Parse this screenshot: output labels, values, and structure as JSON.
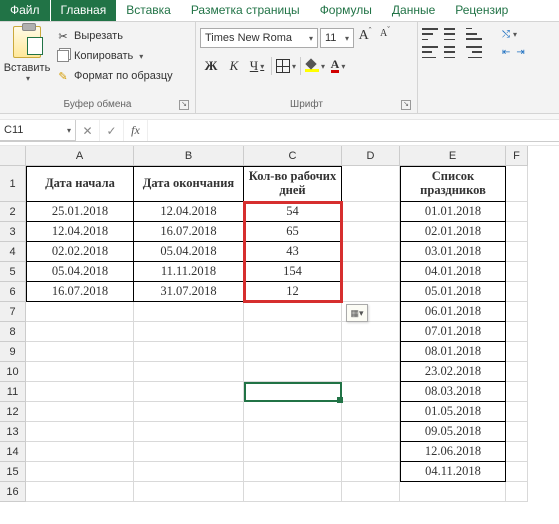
{
  "tabs": {
    "file": "Файл",
    "home": "Главная",
    "insert": "Вставка",
    "layout": "Разметка страницы",
    "formulas": "Формулы",
    "data": "Данные",
    "review": "Рецензир"
  },
  "ribbon": {
    "paste": "Вставить",
    "cut": "Вырезать",
    "copy": "Копировать",
    "format_painter": "Формат по образцу",
    "clipboard_group": "Буфер обмена",
    "font_group": "Шрифт",
    "font_name": "Times New Roma",
    "font_size": "11",
    "bold": "Ж",
    "italic": "К",
    "underline": "Ч",
    "a_letter": "A"
  },
  "name_box": "C11",
  "fx_label": "fx",
  "columns": [
    "A",
    "B",
    "C",
    "D",
    "E",
    "F"
  ],
  "row_numbers": [
    "1",
    "2",
    "3",
    "4",
    "5",
    "6",
    "7",
    "8",
    "9",
    "10",
    "11",
    "12",
    "13",
    "14",
    "15",
    "16"
  ],
  "headers": {
    "A": "Дата начала",
    "B": "Дата окончания",
    "C": "Кол-во рабочих дней",
    "E": "Список праздников"
  },
  "table": [
    {
      "a": "25.01.2018",
      "b": "12.04.2018",
      "c": "54"
    },
    {
      "a": "12.04.2018",
      "b": "16.07.2018",
      "c": "65"
    },
    {
      "a": "02.02.2018",
      "b": "05.04.2018",
      "c": "43"
    },
    {
      "a": "05.04.2018",
      "b": "11.11.2018",
      "c": "154"
    },
    {
      "a": "16.07.2018",
      "b": "31.07.2018",
      "c": "12"
    }
  ],
  "holidays": [
    "01.01.2018",
    "02.01.2018",
    "03.01.2018",
    "04.01.2018",
    "05.01.2018",
    "06.01.2018",
    "07.01.2018",
    "08.01.2018",
    "23.02.2018",
    "08.03.2018",
    "01.05.2018",
    "09.05.2018",
    "12.06.2018",
    "04.11.2018"
  ],
  "chart_data": {
    "type": "table",
    "title": "Кол-во рабочих дней",
    "columns": [
      "Дата начала",
      "Дата окончания",
      "Кол-во рабочих дней"
    ],
    "rows": [
      [
        "25.01.2018",
        "12.04.2018",
        54
      ],
      [
        "12.04.2018",
        "16.07.2018",
        65
      ],
      [
        "02.02.2018",
        "05.04.2018",
        43
      ],
      [
        "05.04.2018",
        "11.11.2018",
        154
      ],
      [
        "16.07.2018",
        "31.07.2018",
        12
      ]
    ],
    "aux": {
      "label": "Список праздников",
      "values": [
        "01.01.2018",
        "02.01.2018",
        "03.01.2018",
        "04.01.2018",
        "05.01.2018",
        "06.01.2018",
        "07.01.2018",
        "08.01.2018",
        "23.02.2018",
        "08.03.2018",
        "01.05.2018",
        "09.05.2018",
        "12.06.2018",
        "04.11.2018"
      ]
    }
  }
}
